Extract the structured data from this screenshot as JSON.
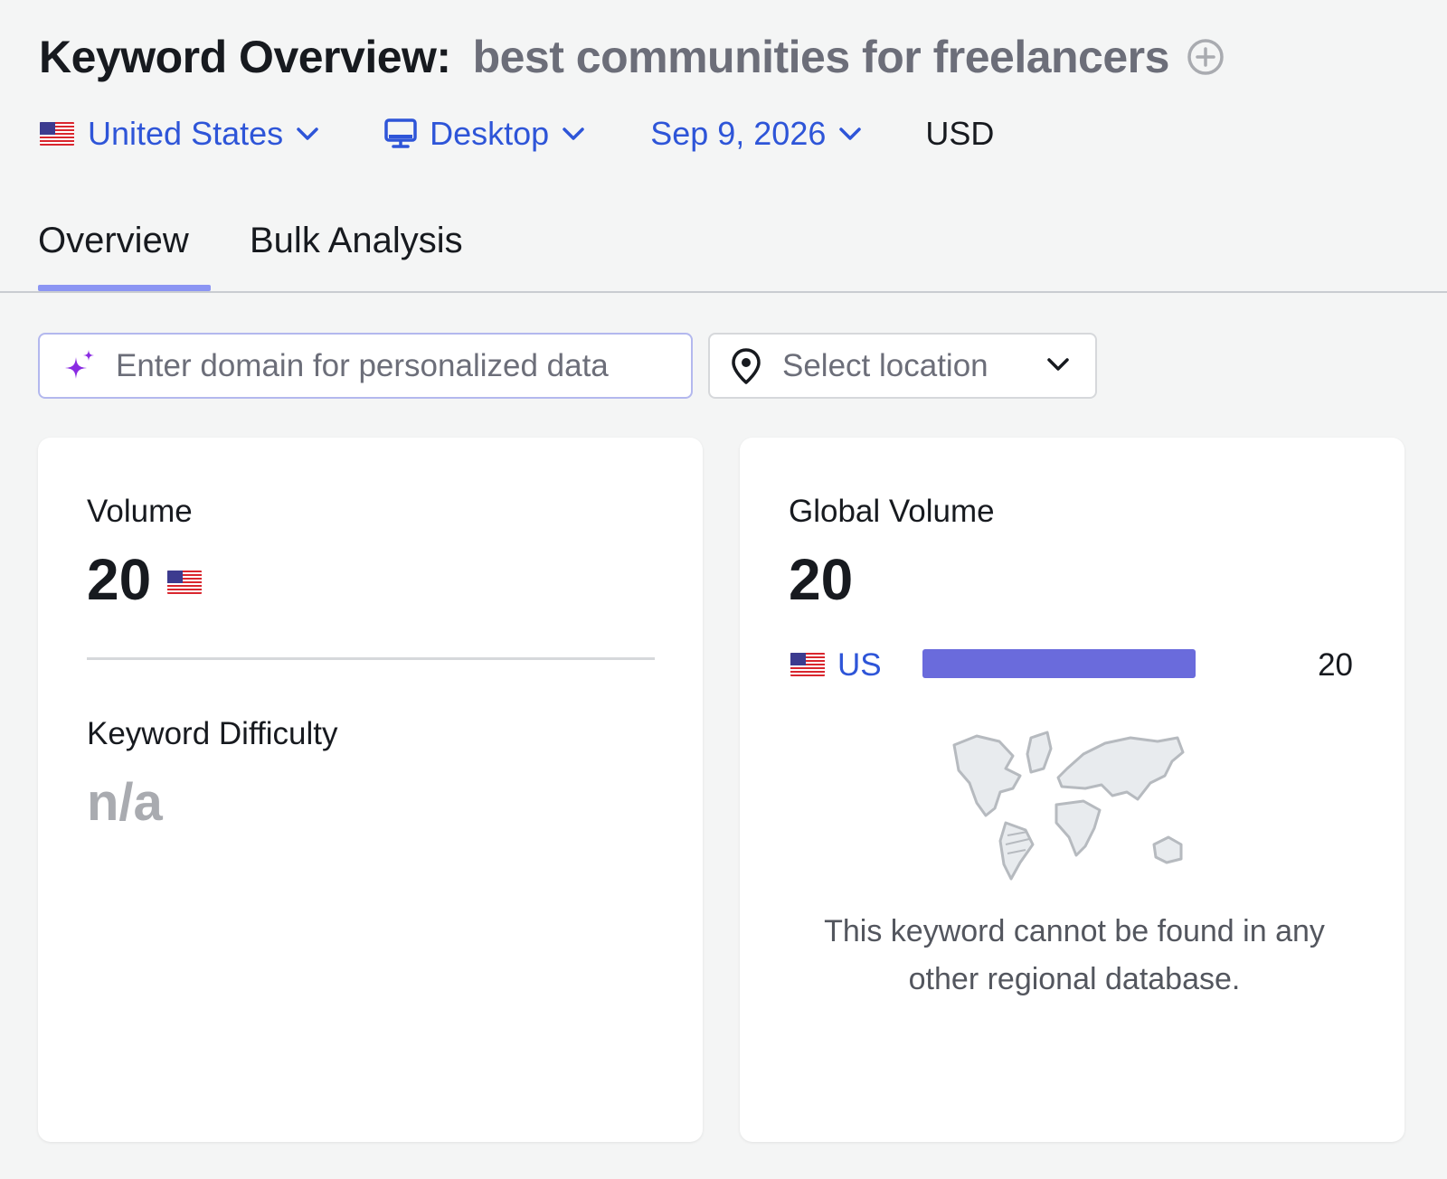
{
  "header": {
    "title_prefix": "Keyword Overview:",
    "keyword": "best communities for freelancers",
    "add_icon": "plus-circle-icon"
  },
  "filters": {
    "country": "United States",
    "device": "Desktop",
    "date": "Sep 9, 2026",
    "currency": "USD"
  },
  "tabs": [
    {
      "label": "Overview",
      "active": true
    },
    {
      "label": "Bulk Analysis",
      "active": false
    }
  ],
  "domain_input": {
    "placeholder": "Enter domain for personalized data",
    "value": "",
    "icon": "sparkle-icon"
  },
  "location_select": {
    "placeholder": "Select location",
    "icon": "map-pin-icon"
  },
  "volume_card": {
    "label": "Volume",
    "value": "20",
    "kd_label": "Keyword Difficulty",
    "kd_value": "n/a"
  },
  "global_card": {
    "label": "Global Volume",
    "value": "20",
    "rows": [
      {
        "country": "US",
        "count": "20",
        "share": 1.0
      }
    ],
    "empty_message": "This keyword cannot be found in any other regional database."
  },
  "colors": {
    "accent_blue": "#2e55d8",
    "bar_fill": "#6a6bdc",
    "tab_underline": "#8b95f3",
    "input_border": "#b3b8ee",
    "na_gray": "#a9abb0"
  }
}
